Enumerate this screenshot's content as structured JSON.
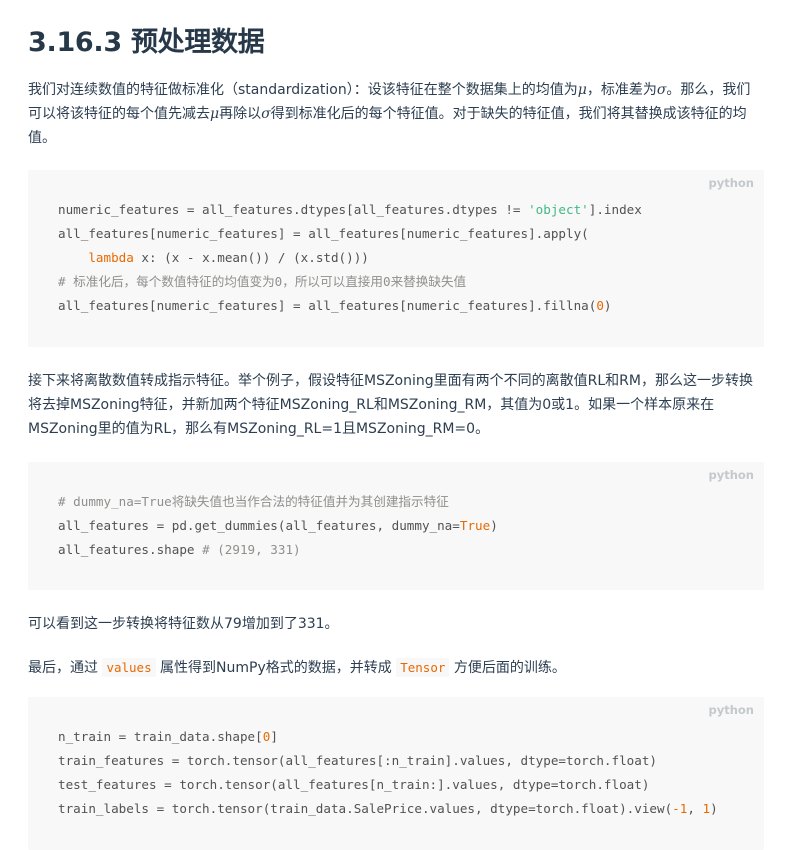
{
  "heading": "3.16.3 预处理数据",
  "paragraph1": {
    "before_mu": "我们对连续数值的特征做标准化（standardization）：设该特征在整个数据集上的均值为",
    "mu": "μ",
    "mid": "，标准差为",
    "sigma": "σ",
    "after_sigma": "。那么，我们可以将该特征的每个值先减去",
    "mu2": "μ",
    "mid2": "再除以",
    "sigma2": "σ",
    "end": "得到标准化后的每个特征值。对于缺失的特征值，我们将其替换成该特征的均值。"
  },
  "code1": {
    "lang": "python",
    "line1_a": "numeric_features = all_features.dtypes[all_features.dtypes != ",
    "line1_str": "'object'",
    "line1_b": "].index",
    "line2": "all_features[numeric_features] = all_features[numeric_features].apply(",
    "line3_indent": "    ",
    "line3_kw": "lambda",
    "line3_rest": " x: (x - x.mean()) / (x.std()))",
    "line4_comment": "# 标准化后，每个数值特征的均值变为0，所以可以直接用0来替换缺失值",
    "line5_a": "all_features[numeric_features] = all_features[numeric_features].fillna(",
    "line5_num": "0",
    "line5_b": ")"
  },
  "paragraph2": "接下来将离散数值转成指示特征。举个例子，假设特征MSZoning里面有两个不同的离散值RL和RM，那么这一步转换将去掉MSZoning特征，并新加两个特征MSZoning_RL和MSZoning_RM，其值为0或1。如果一个样本原来在MSZoning里的值为RL，那么有MSZoning_RL=1且MSZoning_RM=0。",
  "code2": {
    "lang": "python",
    "line1_comment": "# dummy_na=True将缺失值也当作合法的特征值并为其创建指示特征",
    "line2_a": "all_features = pd.get_dummies(all_features, dummy_na=",
    "line2_kw": "True",
    "line2_b": ")",
    "line3_a": "all_features.shape ",
    "line3_comment": "# (2919, 331)"
  },
  "paragraph3": "可以看到这一步转换将特征数从79增加到了331。",
  "paragraph4": {
    "before": "最后，通过 ",
    "code_values": "values",
    "mid": " 属性得到NumPy格式的数据，并转成 ",
    "code_tensor": "Tensor",
    "end": " 方便后面的训练。"
  },
  "code3": {
    "lang": "python",
    "line1_a": "n_train = train_data.shape[",
    "line1_num": "0",
    "line1_b": "]",
    "line2": "train_features = torch.tensor(all_features[:n_train].values, dtype=torch.float)",
    "line3": "test_features = torch.tensor(all_features[n_train:].values, dtype=torch.float)",
    "line4_a": "train_labels = torch.tensor(train_data.SalePrice.values, dtype=torch.float).view(",
    "line4_num1": "-1",
    "line4_sep": ", ",
    "line4_num2": "1",
    "line4_b": ")"
  }
}
